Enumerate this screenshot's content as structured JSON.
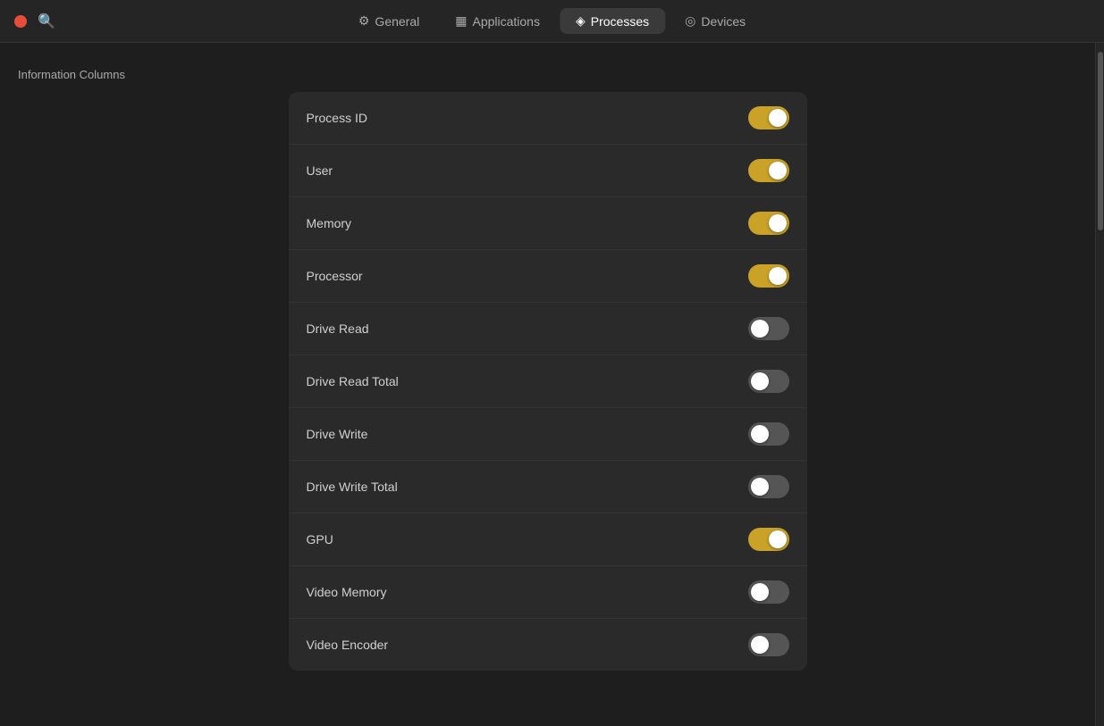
{
  "topbar": {
    "close_button_color": "#e74c3c",
    "tabs": [
      {
        "id": "general",
        "label": "General",
        "icon": "⚙",
        "active": false
      },
      {
        "id": "applications",
        "label": "Applications",
        "icon": "▦",
        "active": false
      },
      {
        "id": "processes",
        "label": "Processes",
        "icon": "◈",
        "active": true
      },
      {
        "id": "devices",
        "label": "Devices",
        "icon": "◎",
        "active": false
      }
    ]
  },
  "section": {
    "title": "Information Columns",
    "rows": [
      {
        "label": "Process ID",
        "state": "on"
      },
      {
        "label": "User",
        "state": "on"
      },
      {
        "label": "Memory",
        "state": "on"
      },
      {
        "label": "Processor",
        "state": "on"
      },
      {
        "label": "Drive Read",
        "state": "off"
      },
      {
        "label": "Drive Read Total",
        "state": "off"
      },
      {
        "label": "Drive Write",
        "state": "off"
      },
      {
        "label": "Drive Write Total",
        "state": "off"
      },
      {
        "label": "GPU",
        "state": "on"
      },
      {
        "label": "Video Memory",
        "state": "off"
      },
      {
        "label": "Video Encoder",
        "state": "off"
      }
    ]
  }
}
